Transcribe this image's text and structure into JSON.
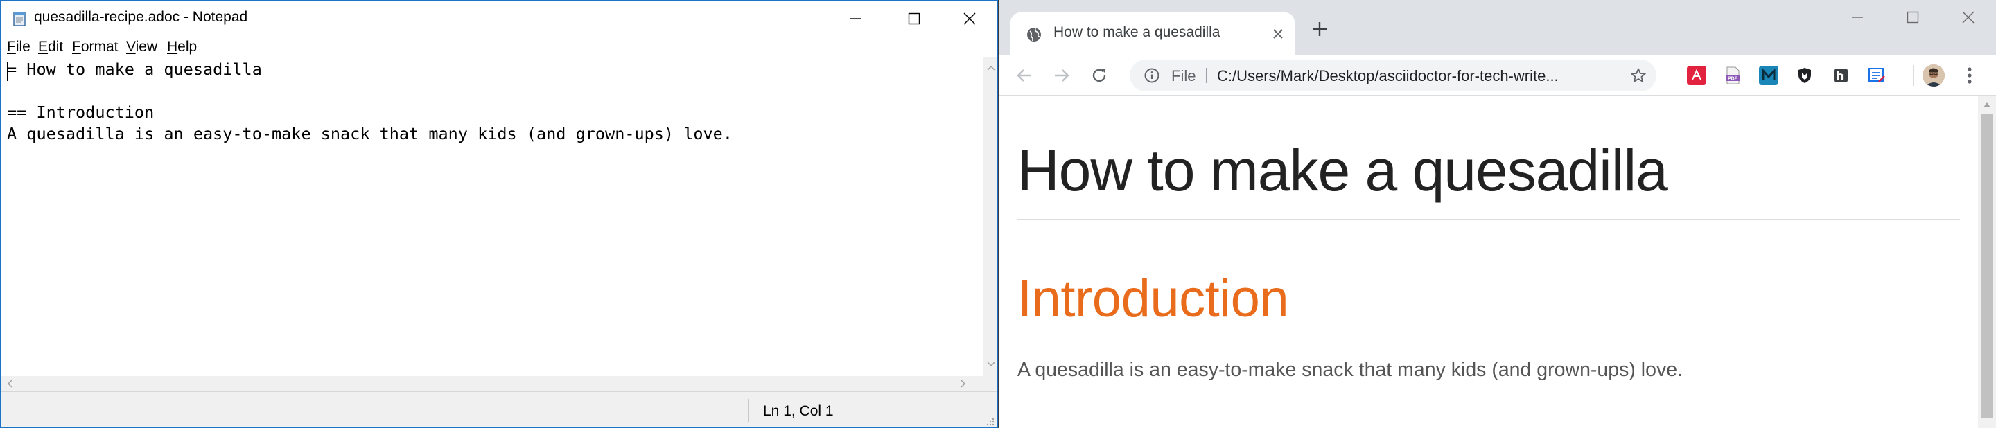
{
  "notepad": {
    "title": "quesadilla-recipe.adoc - Notepad",
    "menu": [
      {
        "key": "F",
        "rest": "ile"
      },
      {
        "key": "E",
        "rest": "dit"
      },
      {
        "key": "F",
        "rest": "ormat"
      },
      {
        "key": "V",
        "rest": "iew"
      },
      {
        "key": "H",
        "rest": "elp"
      }
    ],
    "lines": [
      "= How to make a quesadilla",
      "",
      "== Introduction",
      "A quesadilla is an easy-to-make snack that many kids (and grown-ups) love."
    ],
    "status": "Ln 1, Col 1"
  },
  "chrome": {
    "tab_title": "How to make a quesadilla",
    "omnibox": {
      "scheme_label": "File",
      "url": "C:/Users/Mark/Desktop/asciidoctor-for-tech-write..."
    },
    "extensions": [
      {
        "name": "acrobat-extension-icon",
        "glyph": "A",
        "color": "#e2233f"
      },
      {
        "name": "pdf-extension-icon",
        "glyph": "PDF",
        "color": "#8c59b8"
      },
      {
        "name": "m-extension-icon",
        "glyph": "M",
        "color": "#1a86b8"
      },
      {
        "name": "shield-extension-icon",
        "glyph": "",
        "color": "#202124"
      },
      {
        "name": "h-extension-icon",
        "glyph": "h",
        "color": "#3c4043"
      },
      {
        "name": "notes-extension-icon",
        "glyph": "",
        "color": "#1a73e8"
      }
    ]
  },
  "document": {
    "title": "How to make a quesadilla",
    "section_title": "Introduction",
    "paragraph": "A quesadilla is an easy-to-make snack that many kids (and grown-ups) love."
  },
  "colors": {
    "section_heading": "#e86c1b",
    "window_border": "#1a73c9"
  }
}
